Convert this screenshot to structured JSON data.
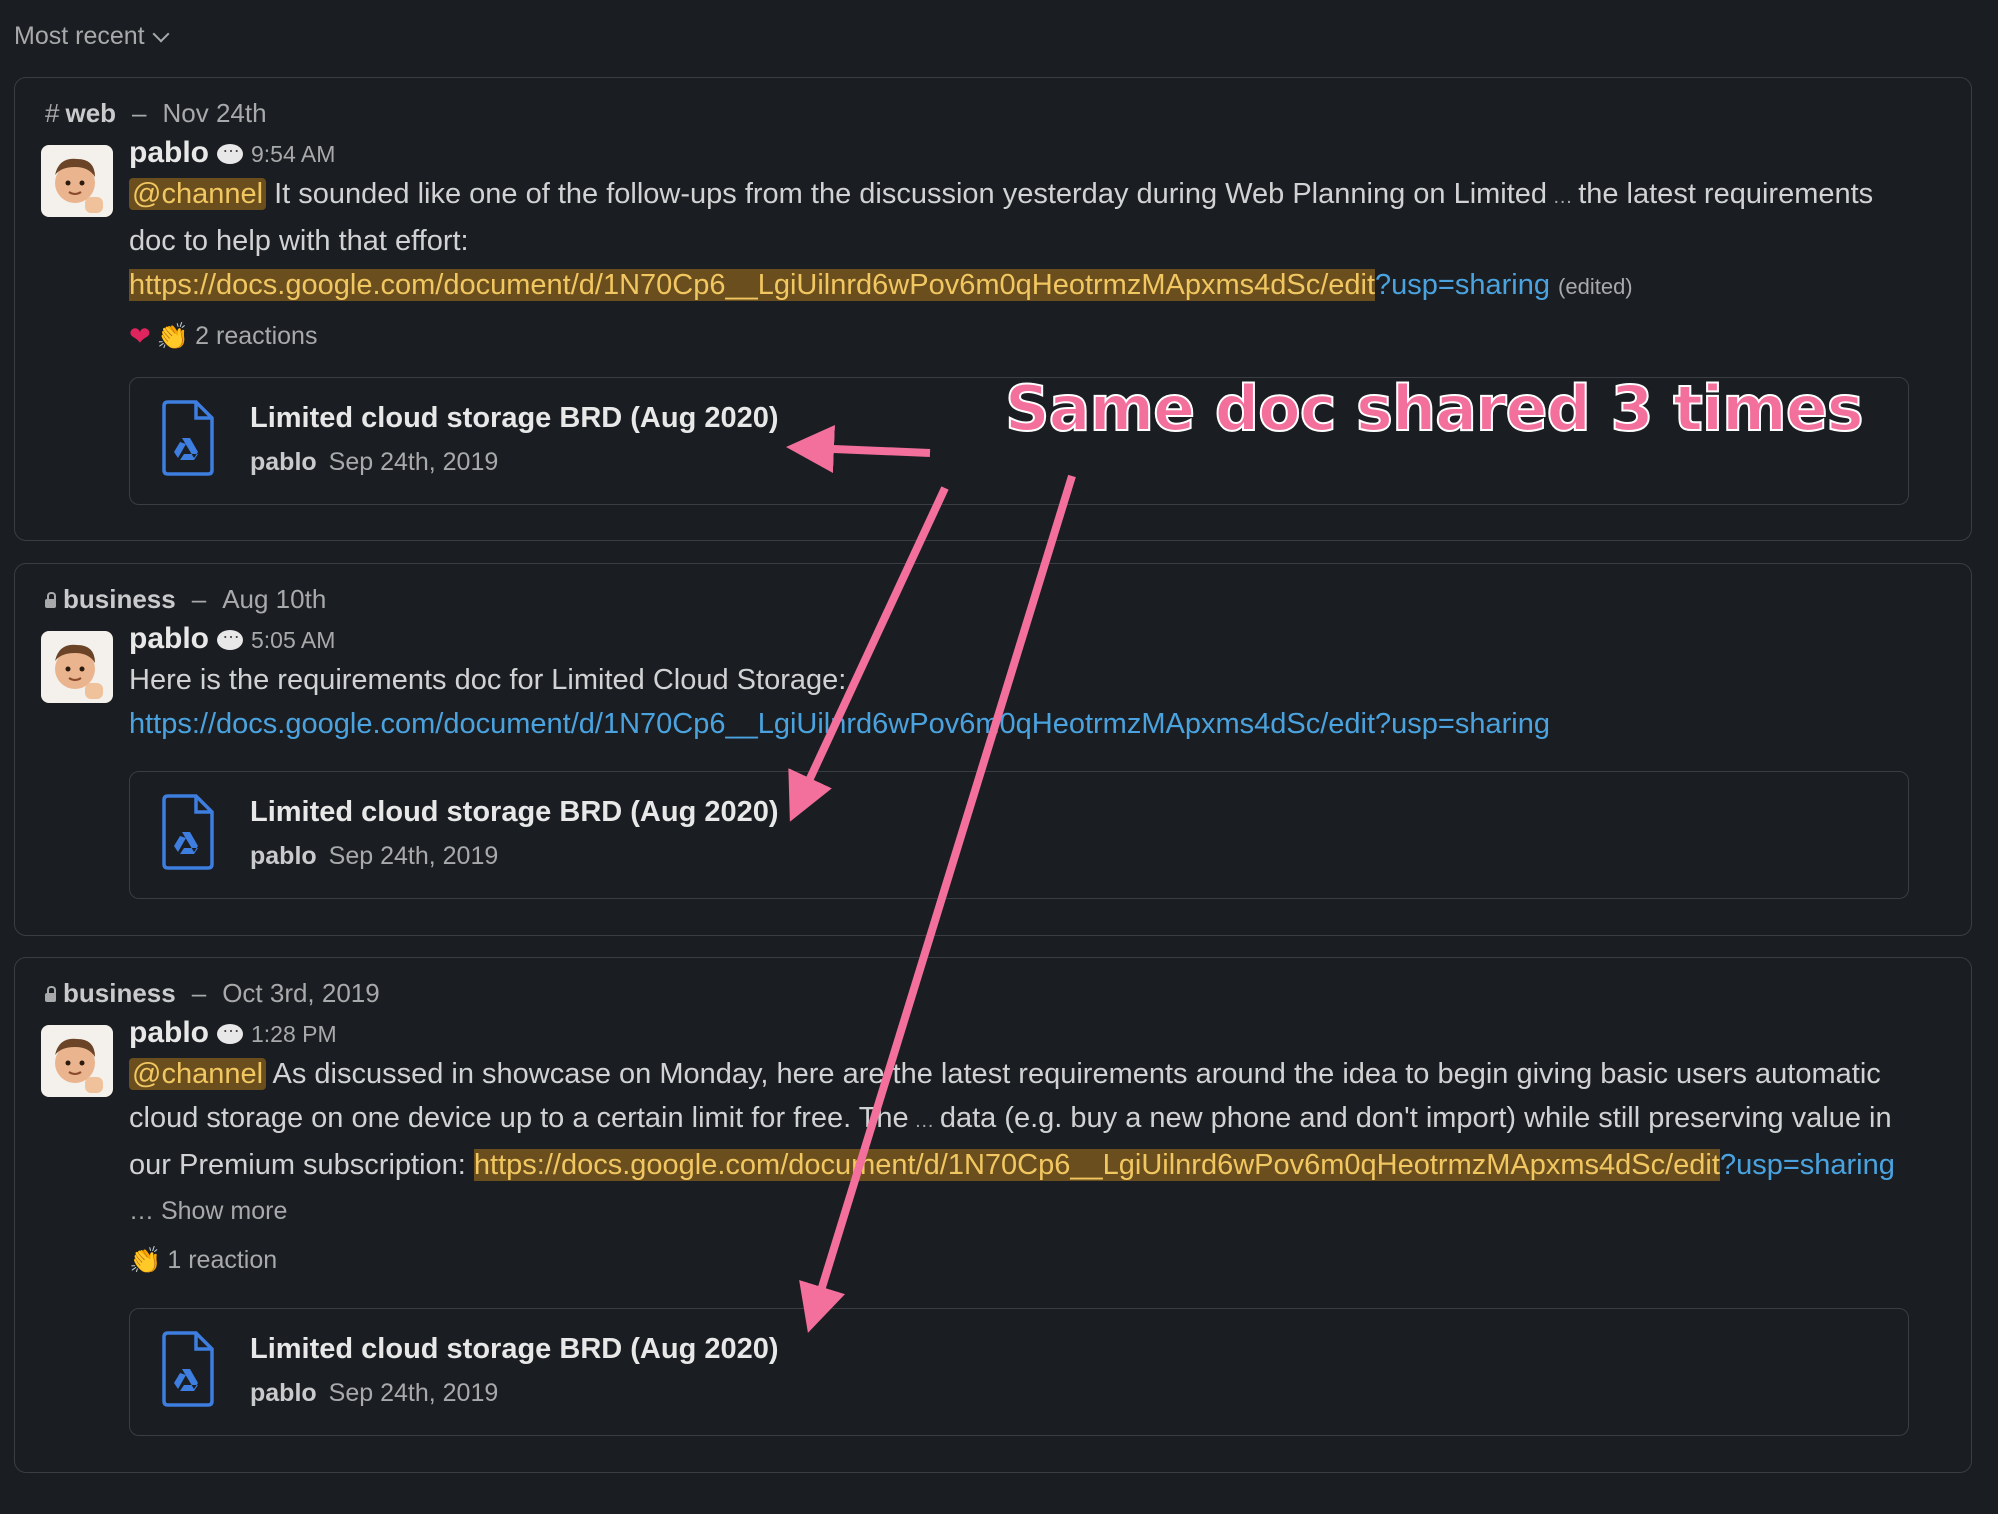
{
  "sort": {
    "label": "Most recent"
  },
  "cards": [
    {
      "channel": "web",
      "channel_prefix": "#",
      "date": "Nov 24th",
      "author": "pablo",
      "time": "9:54 AM",
      "mention": "@channel",
      "text1": " It sounded like one of the follow-ups from the discussion yesterday during Web Planning on Limited",
      "ellipsis": " … ",
      "text2": " the latest requirements doc to help with that effort:",
      "link_hl": "https://docs.google.com/document/d/1N70Cp6__LgiUilnrd6wPov6m0qHeotrmzMApxms4dSc/edit",
      "link_rest": "?usp=sharing",
      "edited": "(edited)",
      "reactions_label": "2 reactions",
      "file_title": "Limited cloud storage BRD (Aug 2020)",
      "file_author": "pablo",
      "file_date": "Sep 24th, 2019"
    },
    {
      "channel": "business",
      "date": "Aug 10th",
      "author": "pablo",
      "time": "5:05 AM",
      "text1": "Here is the requirements doc for Limited Cloud Storage:",
      "link": "https://docs.google.com/document/d/1N70Cp6__LgiUilnrd6wPov6m0qHeotrmzMApxms4dSc/edit?usp=sharing",
      "file_title": "Limited cloud storage BRD (Aug 2020)",
      "file_author": "pablo",
      "file_date": "Sep 24th, 2019"
    },
    {
      "channel": "business",
      "date": "Oct 3rd, 2019",
      "author": "pablo",
      "time": "1:28 PM",
      "mention": "@channel",
      "text1": " As discussed in showcase on Monday, here are the latest requirements around the idea to begin giving basic users automatic cloud storage on one device up to a certain limit for free. The",
      "ellipsis": " … ",
      "text2": " data (e.g. buy a new phone and don't import) while still preserving value in our Premium subscription: ",
      "link_hl": "https://docs.google.com/document/d/1N70Cp6__LgiUilnrd6wPov6m0qHeotrmzMApxms4dSc/edit",
      "link_rest": "?usp=sharing",
      "show_more": " … Show more",
      "reactions_label": "1 reaction",
      "file_title": "Limited cloud storage BRD (Aug 2020)",
      "file_author": "pablo",
      "file_date": "Sep 24th, 2019"
    }
  ],
  "annotation": {
    "text": "Same doc shared 3 times",
    "color": "#f36f9c"
  }
}
